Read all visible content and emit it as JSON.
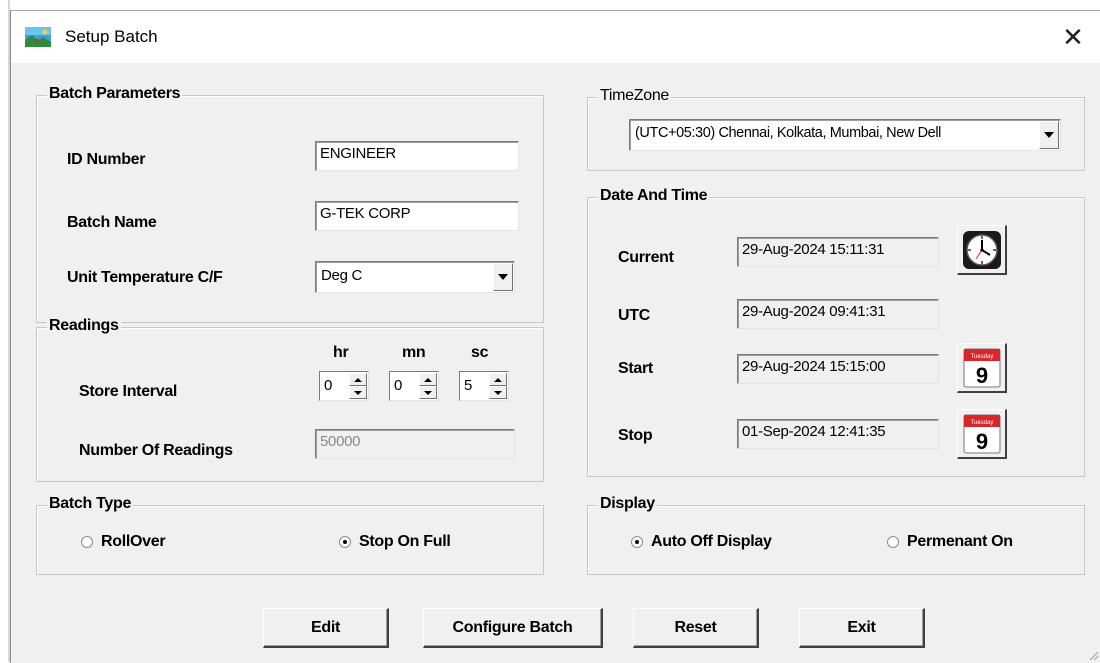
{
  "window": {
    "title": "Setup Batch",
    "close_glyph": "✕"
  },
  "batch_parameters": {
    "legend": "Batch Parameters",
    "id_number_label": "ID Number",
    "id_number_value": "ENGINEER",
    "batch_name_label": "Batch Name",
    "batch_name_value": "G-TEK CORP",
    "unit_temp_label": "Unit Temperature C/F",
    "unit_temp_value": "Deg C"
  },
  "readings": {
    "legend": "Readings",
    "hr_label": "hr",
    "mn_label": "mn",
    "sc_label": "sc",
    "store_interval_label": "Store Interval",
    "hr_value": "0",
    "mn_value": "0",
    "sc_value": "5",
    "num_readings_label": "Number Of Readings",
    "num_readings_value": "50000"
  },
  "batch_type": {
    "legend": "Batch Type",
    "options": [
      {
        "label": "RollOver",
        "selected": false
      },
      {
        "label": "Stop On Full",
        "selected": true
      }
    ]
  },
  "timezone": {
    "legend": "TimeZone",
    "value": "(UTC+05:30) Chennai, Kolkata, Mumbai, New Dell"
  },
  "date_time": {
    "legend": "Date And Time",
    "current_label": "Current",
    "current_value": "29-Aug-2024 15:11:31",
    "utc_label": "UTC",
    "utc_value": "29-Aug-2024 09:41:31",
    "start_label": "Start",
    "start_value": "29-Aug-2024 15:15:00",
    "stop_label": "Stop",
    "stop_value": "01-Sep-2024 12:41:35",
    "calendar_day_name": "Tuesday",
    "calendar_day_number": "9"
  },
  "display": {
    "legend": "Display",
    "options": [
      {
        "label": "Auto Off Display",
        "selected": true
      },
      {
        "label": "Permenant On",
        "selected": false
      }
    ]
  },
  "buttons": {
    "edit": "Edit",
    "configure": "Configure Batch",
    "reset": "Reset",
    "exit": "Exit"
  },
  "colors": {
    "dialog_bg": "#f0f0f0",
    "calendar_red": "#d8262b"
  }
}
